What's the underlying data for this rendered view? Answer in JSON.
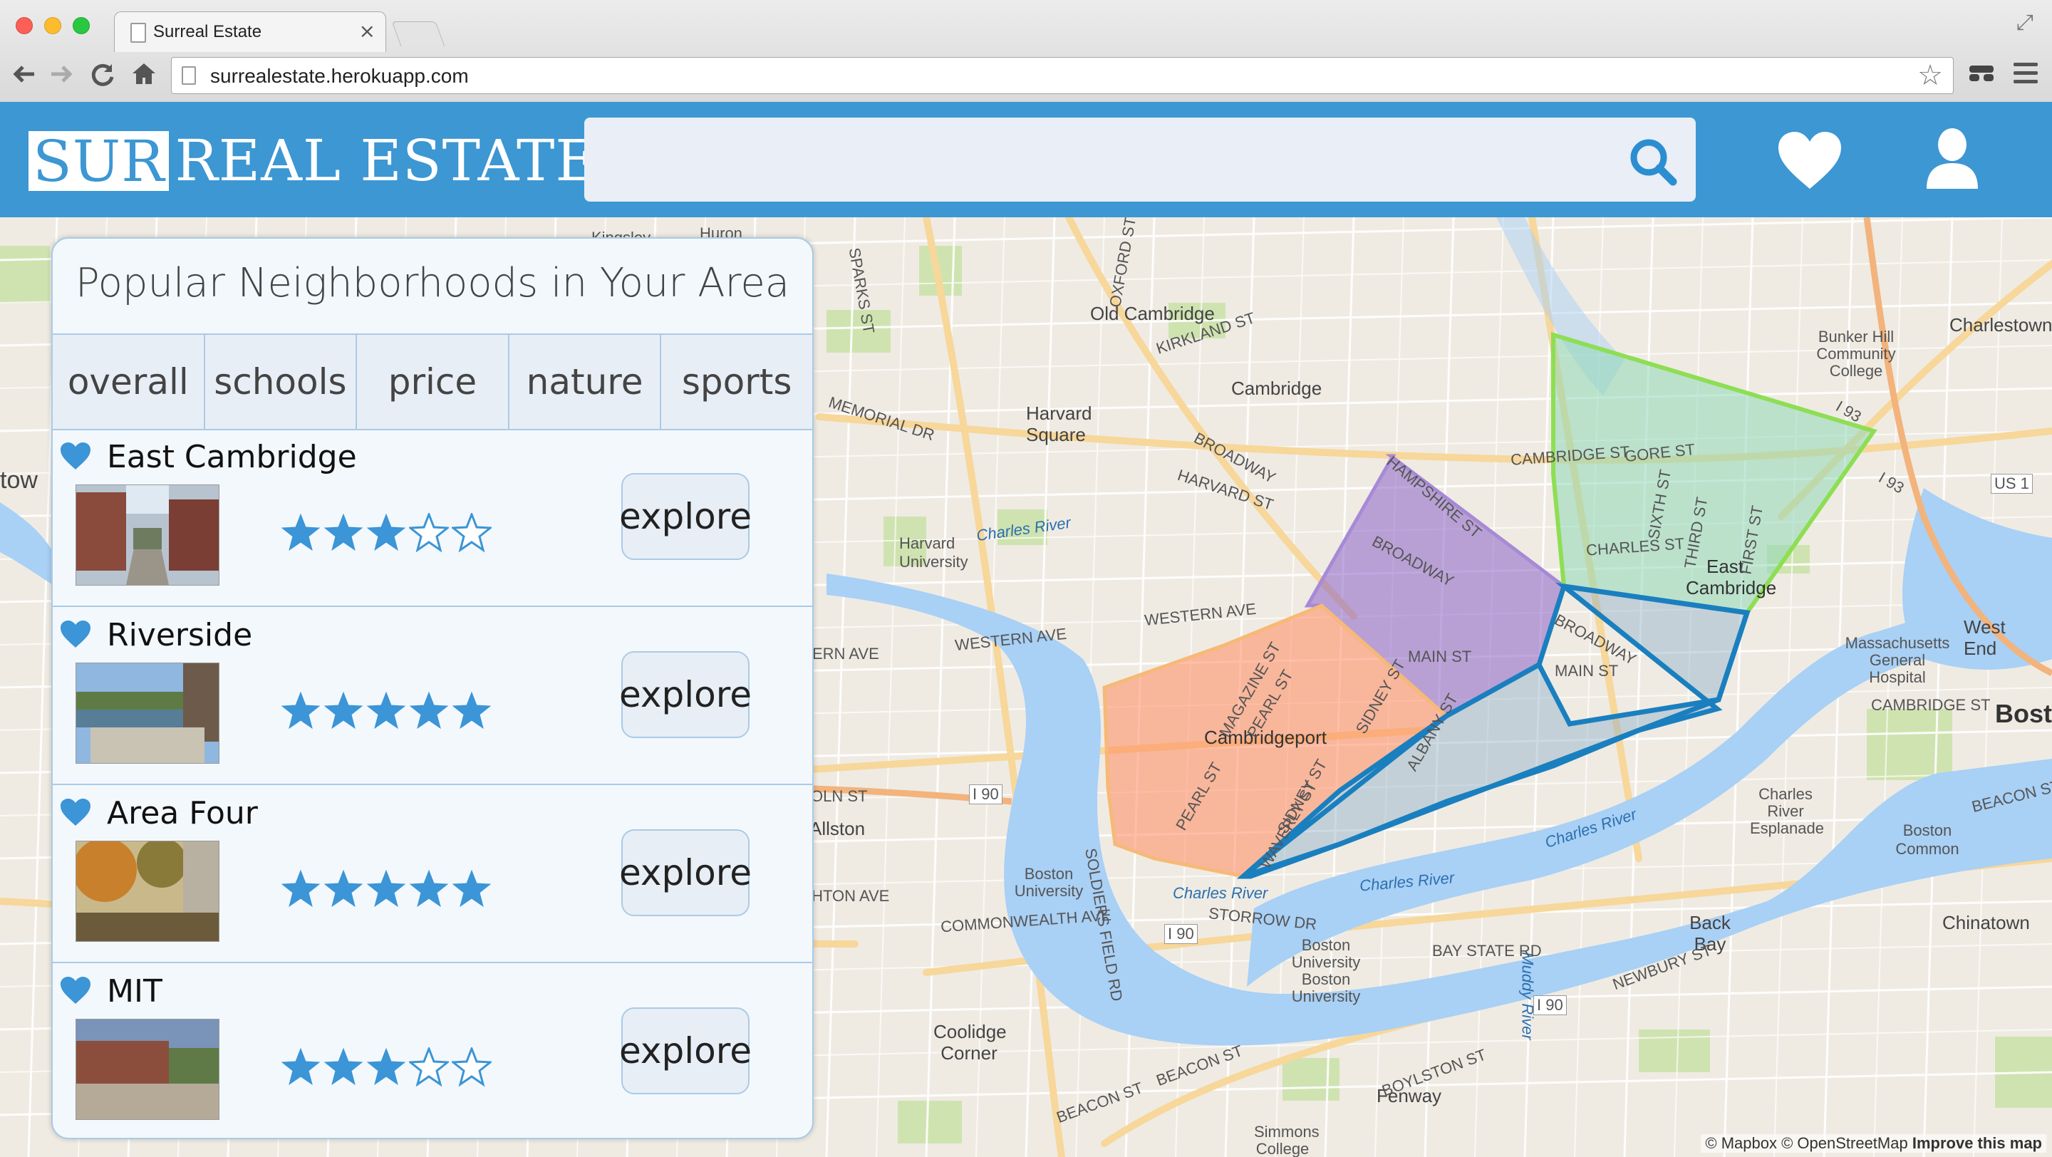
{
  "browser": {
    "tab_title": "Surreal Estate",
    "tab_close": "×",
    "url": "surrealestate.herokuapp.com",
    "nav_icons": [
      "back-icon",
      "forward-icon",
      "reload-icon",
      "home-icon"
    ]
  },
  "app": {
    "logo_highlight": "SUR",
    "logo_rest": "REAL ESTATE",
    "search_placeholder": "",
    "colors": {
      "header": "#3c97d3",
      "accent": "#1f8fcf",
      "panel_bg": "#f3f8fd"
    }
  },
  "panel": {
    "title": "Popular Neighborhoods in Your Area",
    "tabs": [
      {
        "label": "overall",
        "active": true
      },
      {
        "label": "schools",
        "active": false
      },
      {
        "label": "price",
        "active": false
      },
      {
        "label": "nature",
        "active": false
      },
      {
        "label": "sports",
        "active": false
      }
    ],
    "explore_label": "explore",
    "neighborhoods": [
      {
        "name": "East Cambridge",
        "rating": 3,
        "max_rating": 5
      },
      {
        "name": "Riverside",
        "rating": 5,
        "max_rating": 5
      },
      {
        "name": "Area Four",
        "rating": 5,
        "max_rating": 5
      },
      {
        "name": "MIT",
        "rating": 3,
        "max_rating": 5
      }
    ]
  },
  "map": {
    "attribution_1": "© Mapbox © OpenStreetMap",
    "attribution_2": "Improve this map",
    "labels": {
      "old_cambridge": "Old Cambridge",
      "cambridge": "Cambridge",
      "harvard_square": "Harvard Square",
      "harvard_university": "Harvard University",
      "cambridgeport": "Cambridgeport",
      "east_cambridge": "East Cambridge",
      "charlestown": "Charlestown",
      "bunker_hill": "Bunker Hill Community College",
      "mgh": "Massachusetts General Hospital",
      "west_end": "West End",
      "boston": "Bost",
      "boston_common": "Boston Common",
      "back_bay": "Back Bay",
      "chinatown": "Chinatown",
      "allston": "Allston",
      "boston_university": "Boston University",
      "bu_2": "Boston University Boston University",
      "coolidge": "Coolidge Corner",
      "fenway": "Fenway",
      "simmons": "Simmons College",
      "esplanade": "Charles River Esplanade",
      "charles_river": "Charles River",
      "muddy_river": "Muddy River",
      "memorial_dr": "MEMORIAL DR",
      "western_ave": "WESTERN AVE",
      "broadway": "BROADWAY",
      "harvard_st": "HARVARD ST",
      "main_st": "MAIN ST",
      "commonwealth": "COMMONWEALTH AVE",
      "storrow": "STORROW DR",
      "beacon_st": "BEACON ST",
      "bay_state": "BAY STATE RD",
      "cambridge_st": "CAMBRIDGE ST",
      "gore_st": "GORE ST",
      "charles_st": "CHARLES ST",
      "i90": "I 90",
      "i93": "I 93",
      "us1": "US 1",
      "brighton": "RIGHTON AVE",
      "kirkland": "KIRKLAND ST",
      "oxford": "OXFORD ST",
      "hampshire": "HAMPSHIRE ST",
      "magazine": "MAGAZINE ST",
      "pearl": "PEARL ST",
      "sidney": "SIDNEY ST",
      "albany": "ALBANY ST",
      "waverly": "WAVERLY ST",
      "newbury": "NEWBURY ST",
      "boylston": "BOYLSTON ST",
      "kingsley": "Kingsley",
      "huron": "Huron",
      "sparks": "SPARKS ST",
      "soldiers": "SOLDIERS FIELD RD",
      "third": "THIRD ST",
      "sixth": "SIXTH ST",
      "first": "FIRST ST",
      "tow": "tow",
      "olin": "OLN ST",
      "ern": "ERN AVE"
    }
  }
}
